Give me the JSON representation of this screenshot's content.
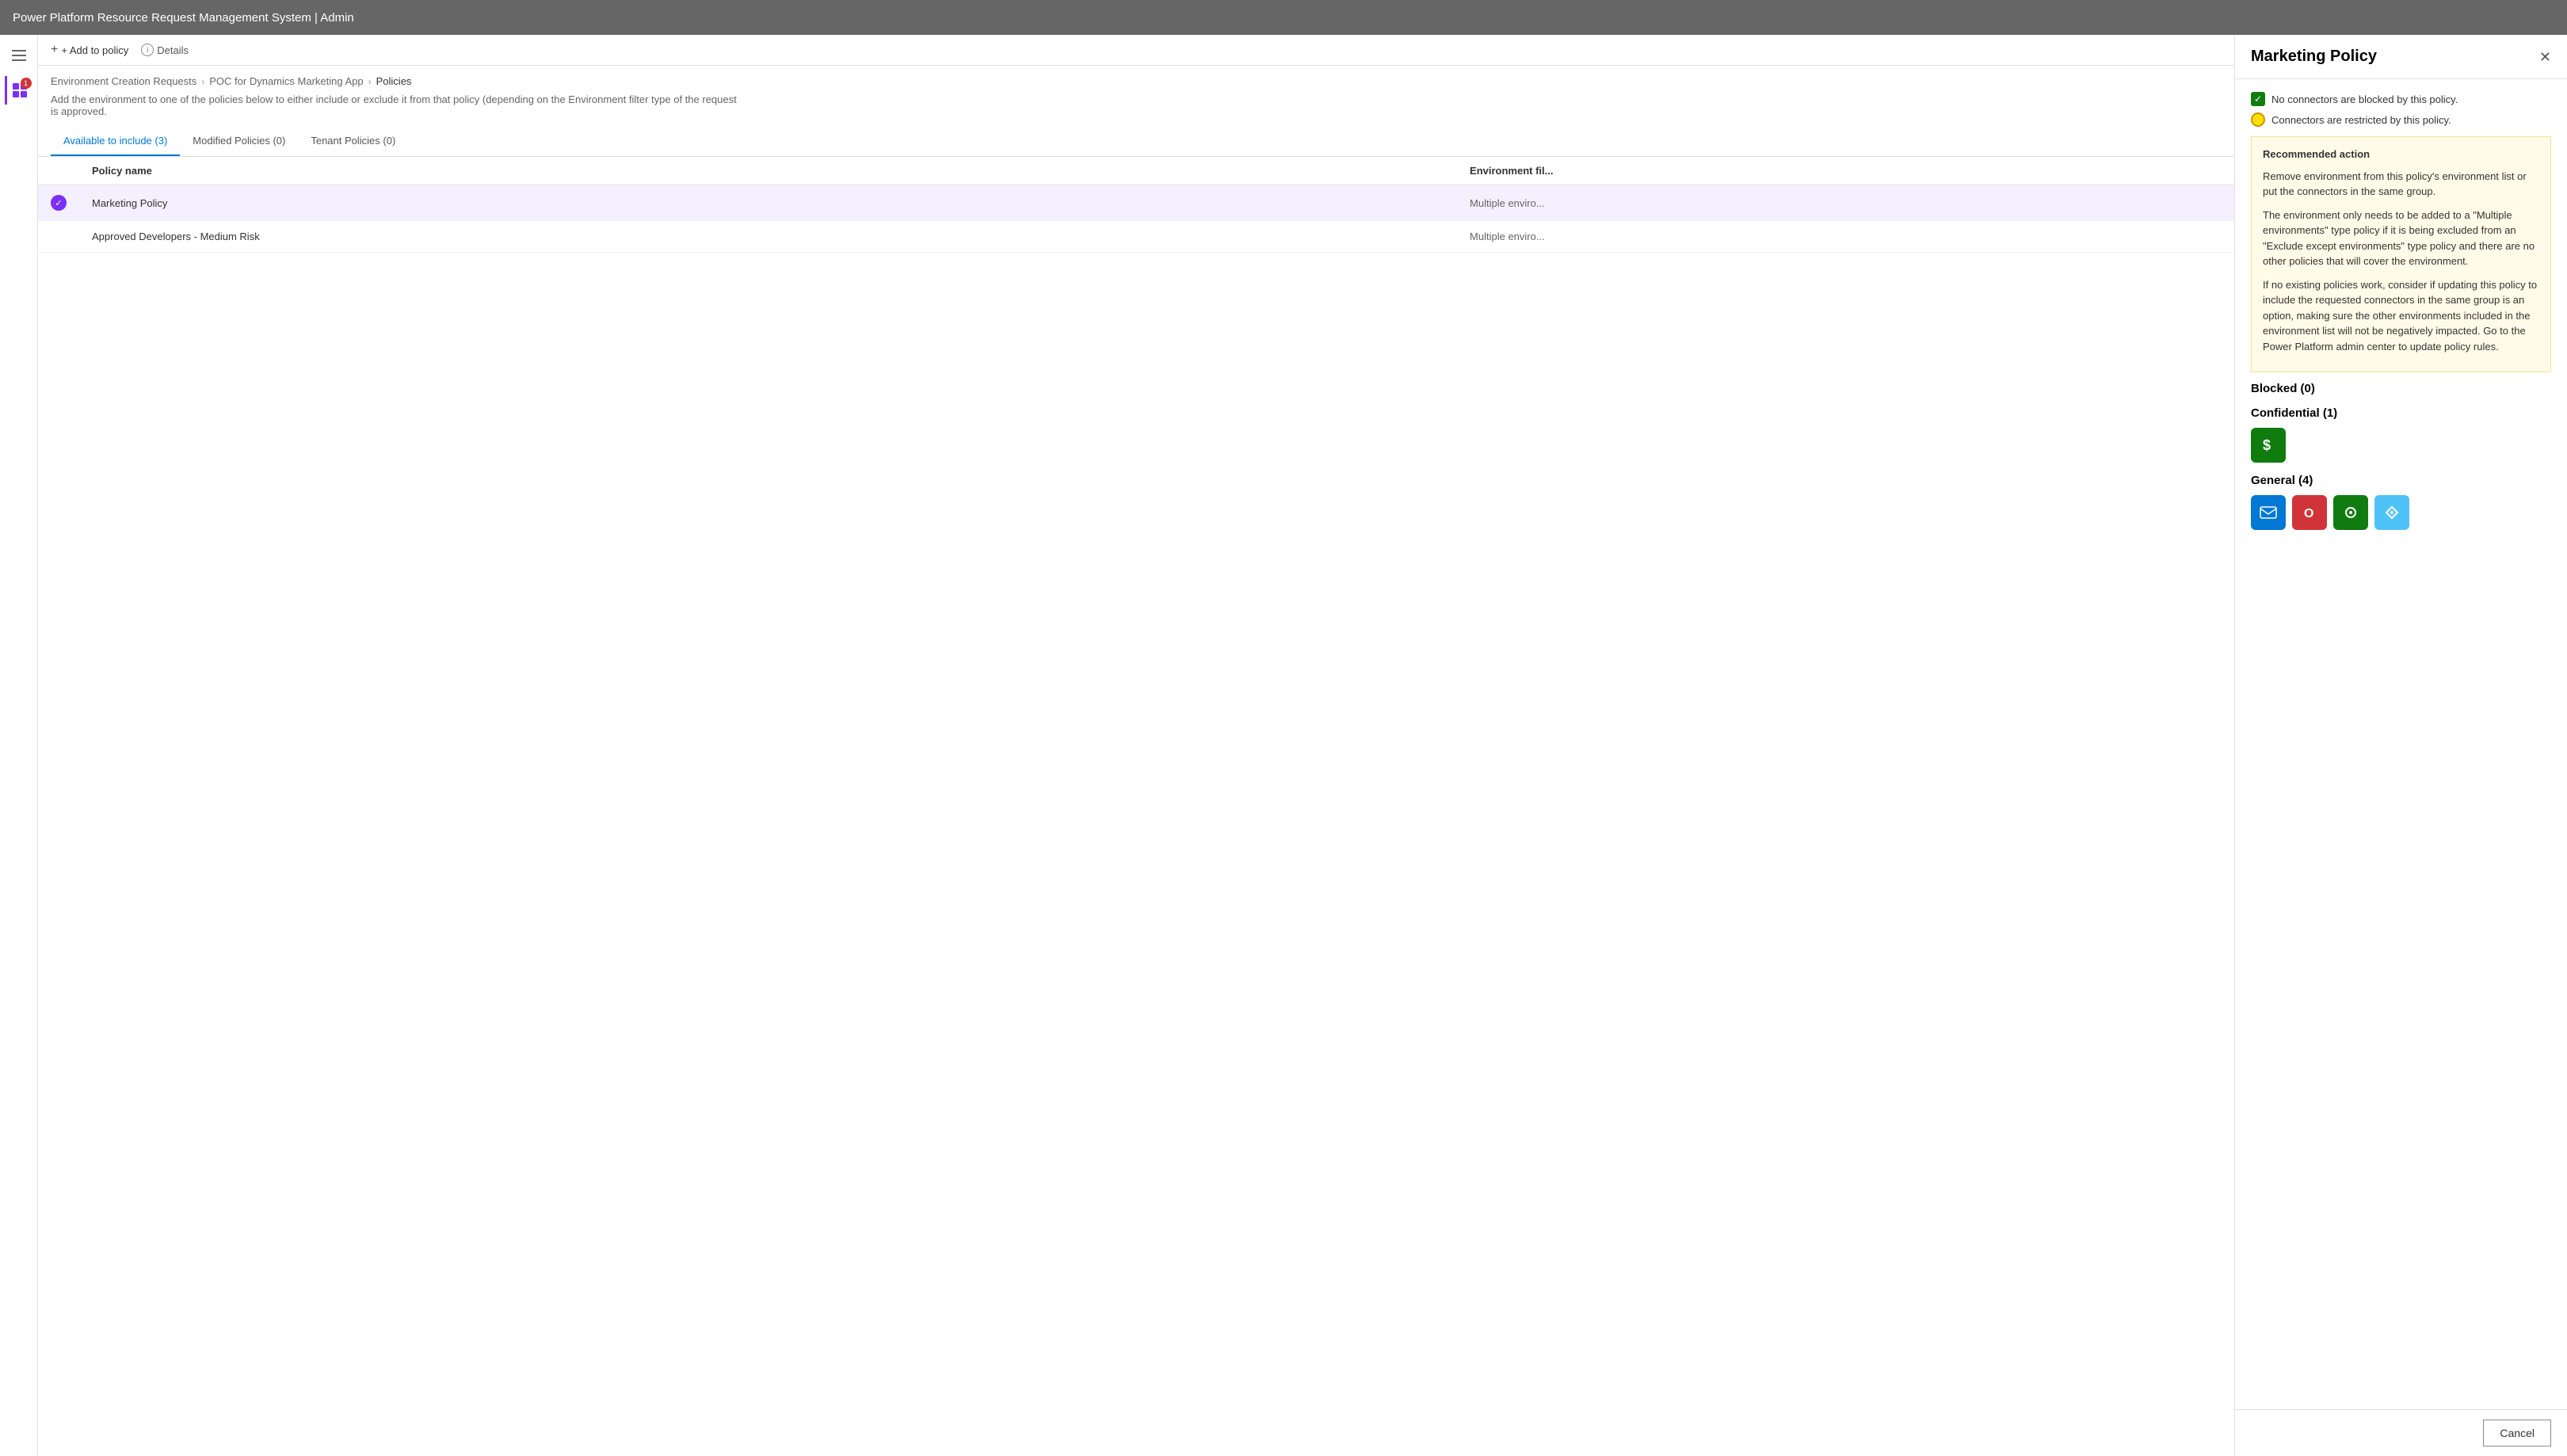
{
  "appTitle": "Power Platform Resource Request Management System | Admin",
  "toolbar": {
    "addToPolicy": "+ Add to policy",
    "details": "Details"
  },
  "breadcrumb": {
    "items": [
      "Environment Creation Requests",
      "POC for Dynamics Marketing App",
      "Policies"
    ]
  },
  "description": "Add the environment to one of the policies below to either include or exclude it from that policy (depending on the Environment filter type of the request is approved.",
  "tabs": [
    {
      "label": "Available to include (3)",
      "active": true
    },
    {
      "label": "Modified Policies (0)",
      "active": false
    },
    {
      "label": "Tenant Policies (0)",
      "active": false
    }
  ],
  "table": {
    "columns": [
      "Policy name",
      "Environment fil..."
    ],
    "rows": [
      {
        "name": "Marketing Policy",
        "env": "Multiple enviro...",
        "selected": true,
        "checked": true
      },
      {
        "name": "Approved Developers - Medium Risk",
        "env": "Multiple enviro...",
        "selected": false,
        "checked": false
      }
    ]
  },
  "panel": {
    "title": "Marketing Policy",
    "status": [
      {
        "type": "green-check",
        "text": "No connectors are blocked by this policy."
      },
      {
        "type": "yellow-dot",
        "text": "Connectors are restricted by this policy."
      }
    ],
    "recommendedAction": {
      "title": "Recommended action",
      "paragraphs": [
        "Remove environment from this policy's environment list or put the connectors in the same group.",
        "The environment only needs to be added to a \"Multiple environments\" type policy if it is being excluded from an \"Exclude except environments\" type policy and there are no other policies that will cover the environment.",
        "If no existing policies work, consider if updating this policy to include the requested connectors in the same group is an option, making sure the other environments included in the environment list will not be negatively impacted. Go to the Power Platform admin center to update policy rules."
      ]
    },
    "blocked": {
      "label": "Blocked (0)",
      "icons": []
    },
    "confidential": {
      "label": "Confidential (1)",
      "icons": [
        "dollar-sign"
      ]
    },
    "general": {
      "label": "General (4)",
      "icons": [
        "exchange",
        "office",
        "green-connector",
        "blue-connector"
      ]
    },
    "cancelButton": "Cancel"
  }
}
